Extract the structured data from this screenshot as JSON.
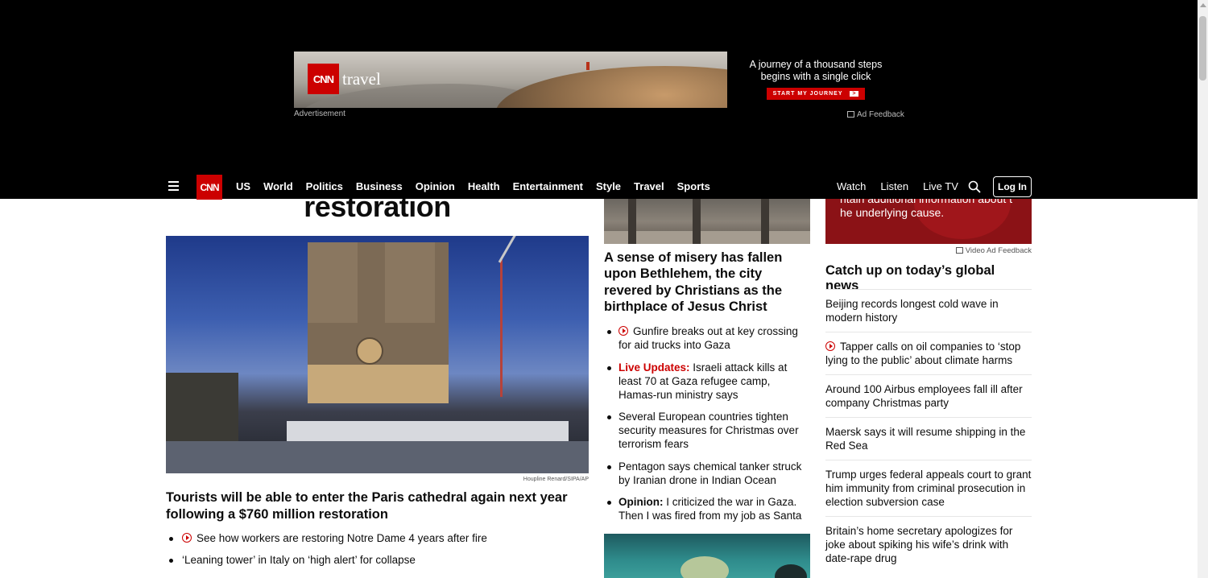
{
  "ad": {
    "brand_logo": "CNN",
    "brand_word": "travel",
    "copy_line1": "A journey of a thousand steps",
    "copy_line2": "begins with a single click",
    "cta": "START MY JOURNEY",
    "cta_arrow": ">",
    "label": "Advertisement",
    "feedback": "Ad Feedback"
  },
  "nav": {
    "logo": "CNN",
    "links": [
      "US",
      "World",
      "Politics",
      "Business",
      "Opinion",
      "Health",
      "Entertainment",
      "Style",
      "Travel",
      "Sports"
    ],
    "right_links": [
      "Watch",
      "Listen",
      "Live TV"
    ],
    "login": "Log In"
  },
  "left": {
    "headline_partial": "restoration",
    "image_credit": "Houpline Renard/SIPA/AP",
    "headline": "Tourists will be able to enter the Paris cathedral again next year following a $760 million restoration",
    "bullets": [
      "See how workers are restoring Notre Dame 4 years after fire",
      "‘Leaning tower’ in Italy on ‘high alert’ for collapse"
    ]
  },
  "middle": {
    "headline": "A sense of misery has fallen upon Bethlehem, the city revered by Christians as the birthplace of Jesus Christ",
    "bullets": [
      {
        "prefix": "",
        "text": "Gunfire breaks out at key crossing for aid trucks into Gaza"
      },
      {
        "prefix": "Live Updates:",
        "text": " Israeli attack kills at least 70 at Gaza refugee camp, Hamas-run ministry says"
      },
      {
        "prefix": "",
        "text": "Several European countries tighten security measures for Christmas over terrorism fears"
      },
      {
        "prefix": "",
        "text": "Pentagon says chemical tanker struck by Iranian drone in Indian Ocean"
      },
      {
        "prefix": "Opinion:",
        "text": " I criticized the war in Gaza. Then I was fired from my job as Santa"
      }
    ]
  },
  "right": {
    "video_ad_line1": "ntain additional information about t",
    "video_ad_line2": "he underlying cause.",
    "video_feedback": "Video Ad Feedback",
    "section_title": "Catch up on today’s global news",
    "items": [
      "Beijing records longest cold wave in modern history",
      "Tapper calls on oil companies to ‘stop lying to the public’ about climate harms",
      "Around 100 Airbus employees fall ill after company Christmas party",
      "Maersk says it will resume shipping in the Red Sea",
      "Trump urges federal appeals court to grant him immunity from criminal prosecution in election subversion case",
      "Britain’s home secretary apologizes for joke about spiking his wife’s drink with date-rape drug"
    ]
  },
  "colors": {
    "brand_red": "#cc0000",
    "nav_bg": "#000000"
  }
}
